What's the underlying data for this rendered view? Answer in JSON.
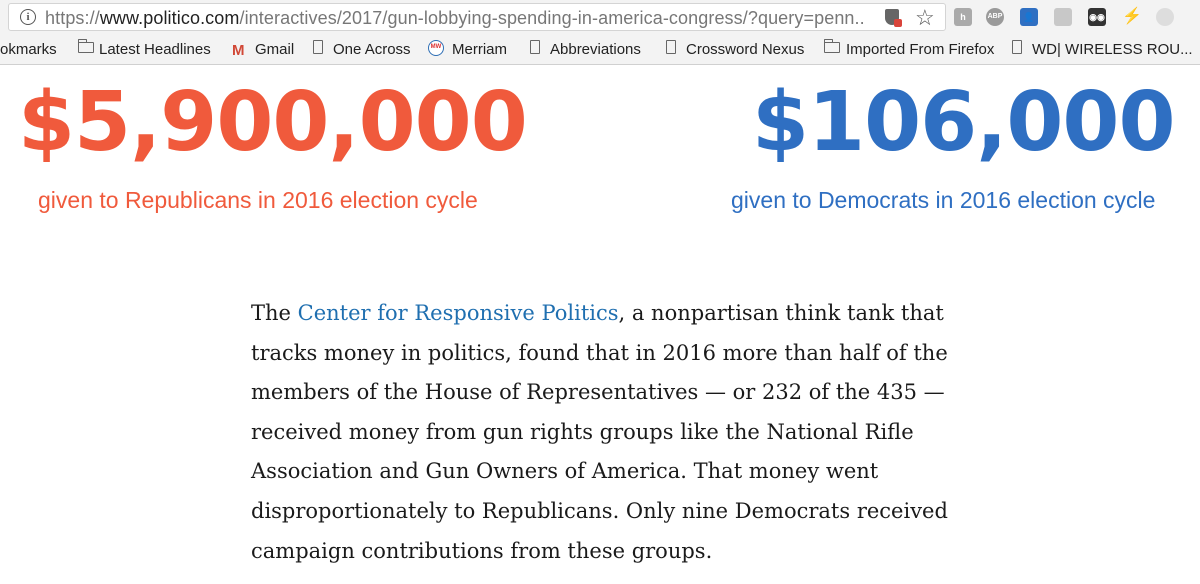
{
  "browser": {
    "url_prefix": "https://",
    "url_domain": "www.politico.com",
    "url_path": "/interactives/2017/gun-lobbying-spending-in-america-congress/?query=penn..."
  },
  "bookmarks": [
    {
      "label": "okmarks",
      "icon": "none"
    },
    {
      "label": "Latest Headlines",
      "icon": "folder-icon"
    },
    {
      "label": "Gmail",
      "icon": "gmail-icon"
    },
    {
      "label": "One Across",
      "icon": "page-icon"
    },
    {
      "label": "Merriam",
      "icon": "merriam-webster-icon"
    },
    {
      "label": "Abbreviations",
      "icon": "page-icon"
    },
    {
      "label": "Crossword Nexus",
      "icon": "page-icon"
    },
    {
      "label": "Imported From Firefox",
      "icon": "folder-icon"
    },
    {
      "label": "WD| WIRELESS ROU...",
      "icon": "page-icon"
    }
  ],
  "extensions": [
    "h-icon",
    "ABP",
    "contacts-icon",
    "camera-icon",
    "glasses-icon",
    "wand-icon",
    "shield-extension-icon"
  ],
  "stats": {
    "republicans_amount": "$5,900,000",
    "republicans_caption": "given to Republicans in 2016 election cycle",
    "democrats_amount": "$106,000",
    "democrats_caption": "given to Democrats in 2016 election cycle"
  },
  "colors": {
    "republican": "#f05a3c",
    "democrat": "#2f6fc2",
    "link": "#1f6fb0"
  },
  "article": {
    "line1_pre": "The ",
    "line1_link": "Center for Responsive Politics",
    "line1_post": ", a nonpartisan think tank that",
    "line2": "tracks money in politics, found that in 2016 more than half of the",
    "line3": "members of the House of Representatives — or 232 of the 435 —",
    "line4": "received money from gun rights groups like the National Rifle",
    "line5": "Association and Gun Owners of America. That money went",
    "line6": "disproportionately to Republicans. Only nine Democrats received",
    "line7": "campaign contributions from these groups."
  }
}
